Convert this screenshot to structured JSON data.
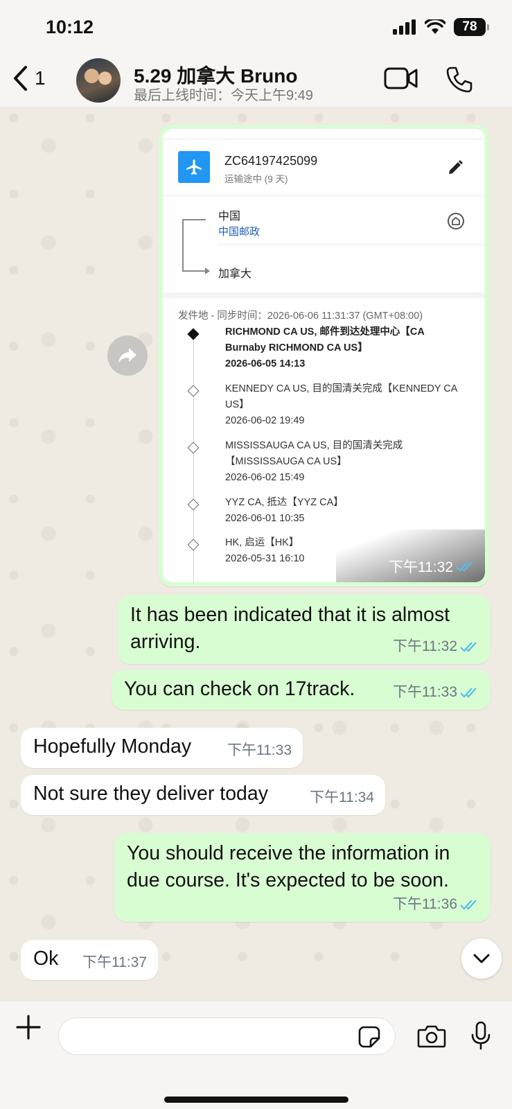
{
  "status_bar": {
    "time": "10:12",
    "battery": "78"
  },
  "header": {
    "back_count": "1",
    "contact_name": "5.29 加拿大 Bruno",
    "last_seen": "最后上线时间：今天上午9:49"
  },
  "tracking_card": {
    "tracking_number": "ZC64197425099",
    "transit_status": "运输途中 (9 天)",
    "origin": "中国",
    "carrier": "中国邮政",
    "destination": "加拿大",
    "sync_line": "发件地 - 同步时间：2026-06-06 11:31:37 (GMT+08:00)",
    "events": [
      {
        "desc": "RICHMOND CA US, 邮件到达处理中心【CA Burnaby RICHMOND CA US】",
        "time": "2026-06-05 14:13"
      },
      {
        "desc": "KENNEDY CA US, 目的国清关完成【KENNEDY CA US】",
        "time": "2026-06-02 19:49"
      },
      {
        "desc": "MISSISSAUGA CA US, 目的国清关完成【MISSISSAUGA CA US】",
        "time": "2026-06-02 15:49"
      },
      {
        "desc": "YYZ CA, 抵达【YYZ CA】",
        "time": "2026-06-01 10:35"
      },
      {
        "desc": "HK, 启运【HK】",
        "time": "2026-05-31 16:10"
      }
    ],
    "sent_time": "下午11:32"
  },
  "messages": [
    {
      "text": "It has been indicated that it is almost arriving.",
      "time": "下午11:32"
    },
    {
      "text": "You can check on 17track.",
      "time": "下午11:33"
    },
    {
      "text": "Hopefully Monday",
      "time": "下午11:33"
    },
    {
      "text": "Not sure they deliver today",
      "time": "下午11:34"
    },
    {
      "text": "You should receive the information in due course. It's expected to be soon.",
      "time": "下午11:36"
    },
    {
      "text": "Ok",
      "time": "下午11:37"
    }
  ],
  "input": {
    "value": ""
  },
  "colors": {
    "outgoing": "#d9fdd3",
    "incoming": "#ffffff",
    "read_ticks": "#53bdeb",
    "wallpaper": "#efeae2"
  },
  "icons": [
    "back-chevron-icon",
    "video-call-icon",
    "phone-icon",
    "plane-icon",
    "edit-icon",
    "home-icon",
    "forward-icon",
    "chevron-down-icon",
    "plus-icon",
    "sticker-icon",
    "camera-icon",
    "mic-icon"
  ]
}
